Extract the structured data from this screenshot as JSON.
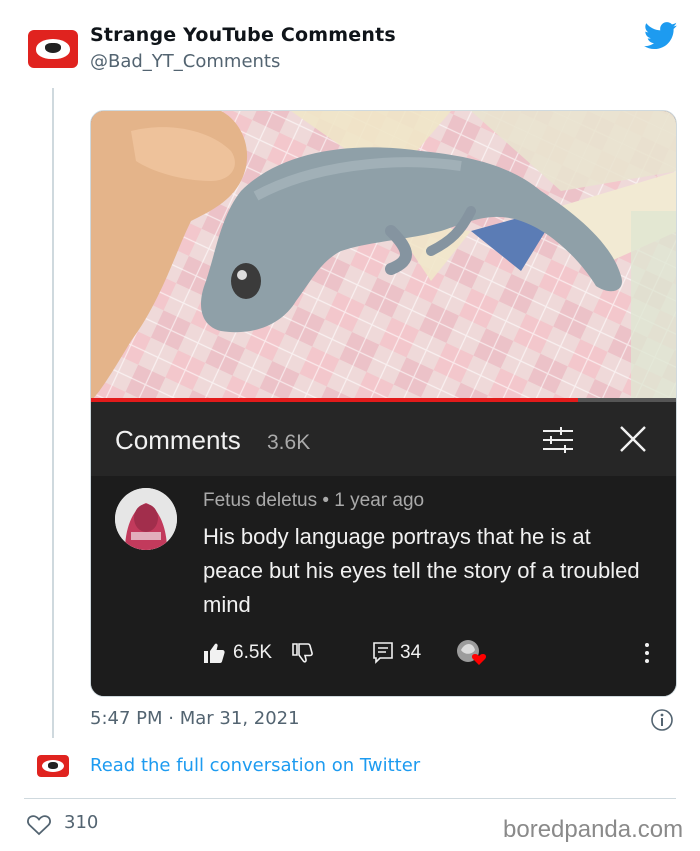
{
  "colors": {
    "twitter_blue": "#1d9bf0",
    "text_secondary": "#536471",
    "yt_dark": "#1c1c1c",
    "yt_progress": "#e21b1b"
  },
  "tweet": {
    "author": {
      "display_name": "Strange YouTube Comments",
      "handle": "@Bad_YT_Comments",
      "avatar_icon": "alien-face-logo"
    },
    "brand_icon": "twitter-bird-icon",
    "time": "5:47 PM",
    "separator": "·",
    "date": "Mar 31, 2021",
    "read_link": "Read the full conversation on Twitter",
    "likes": "310"
  },
  "media": {
    "photo_subject": "lizard-photo",
    "progress_fraction": 0.83,
    "yt_panel": {
      "title": "Comments",
      "count": "3.6K",
      "comment": {
        "author": "Fetus deletus",
        "bullet": "•",
        "age": "1 year ago",
        "text": "His body language portrays that he is at peace but his eyes tell the story of a troubled mind",
        "likes": "6.5K",
        "replies": "34"
      }
    }
  },
  "watermark": "boredpanda.com"
}
